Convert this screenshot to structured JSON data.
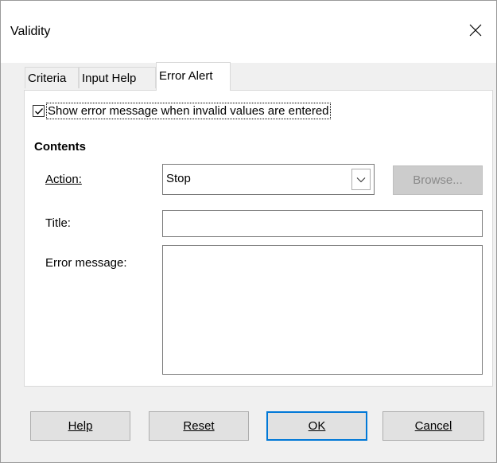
{
  "window": {
    "title": "Validity",
    "close_icon": "close-icon"
  },
  "tabs": [
    {
      "label": "Criteria",
      "active": false
    },
    {
      "label": "Input Help",
      "active": false
    },
    {
      "label": "Error Alert",
      "active": true
    }
  ],
  "error_alert": {
    "show_error": {
      "label": "Show error message when invalid values are entered",
      "checked": true
    },
    "contents_heading": "Contents",
    "action": {
      "label": "Action:",
      "value": "Stop"
    },
    "browse_label": "Browse...",
    "title_label": "Title:",
    "title_value": "",
    "error_message_label": "Error message:",
    "error_message_value": ""
  },
  "buttons": {
    "help": "Help",
    "reset": "Reset",
    "ok": "OK",
    "cancel": "Cancel"
  },
  "colors": {
    "default_button_border": "#0078d7",
    "disabled_button_bg": "#cccccc"
  }
}
